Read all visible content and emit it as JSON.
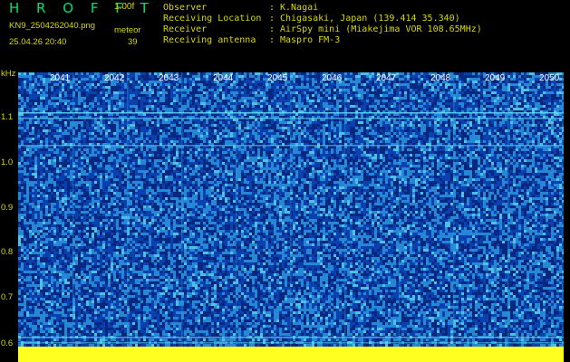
{
  "header": {
    "app_title": "H R O F F T",
    "version": "1.00f",
    "filename": "KN9_2504262040.png",
    "datetime": "25.04.26 20:40",
    "meteor_label": "meteor",
    "meteor_count": "39",
    "fields": [
      {
        "label": "Observer",
        "sep": ":",
        "value": "K.Nagai"
      },
      {
        "label": "Receiving Location",
        "sep": ":",
        "value": "Chigasaki, Japan (139.414 35.340)"
      },
      {
        "label": "Receiver",
        "sep": ":",
        "value": "AirSpy mini (Miakejima VOR 108.65MHz)"
      },
      {
        "label": "Receiving antenna",
        "sep": ":",
        "value": "Maspro FM-3"
      }
    ]
  },
  "spectrogram": {
    "y_unit": "kHz",
    "y_ticks": [
      "1.1",
      "1.0",
      "0.9",
      "0.8",
      "0.7",
      "0.6"
    ],
    "x_ticks": [
      "2041",
      "2042",
      "2043",
      "2044",
      "2045",
      "2046",
      "2047",
      "2048",
      "2049",
      "2050"
    ],
    "colors": {
      "background": "#0a40b0",
      "noise_light": "#30a0e0",
      "noise_cyan": "#60e0f0",
      "noise_dark": "#082880",
      "bar": "#ffff20",
      "axis_text": "#d8d800"
    }
  }
}
